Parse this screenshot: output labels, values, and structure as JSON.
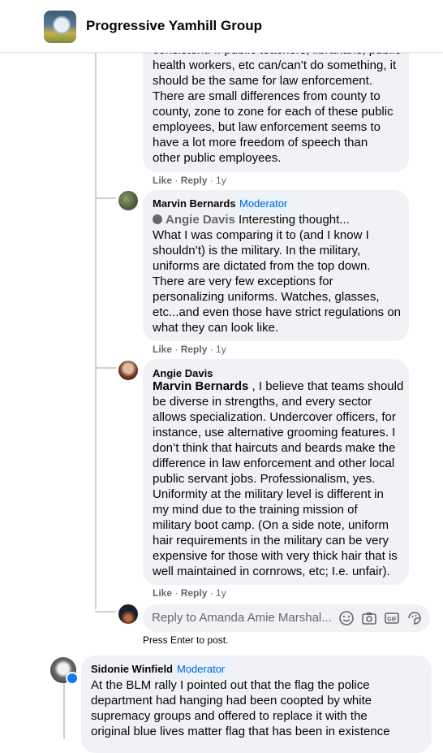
{
  "header": {
    "group_name": "Progressive Yamhill Group"
  },
  "comment_top": {
    "text": "consistent. If public teachers, librarians, public\nhealth workers, etc can/can’t do something, it\nshould be the same for law enforcement.\nThere are small differences from county to\ncounty, zone to zone for each of these public\nemployees, but law enforcement seems to\nhave a lot more freedom of speech than\nother public employees.",
    "like": "Like",
    "reply": "Reply",
    "age": "1y"
  },
  "comment_marvin": {
    "author": "Marvin Bernards",
    "badge": "Moderator",
    "mention": "Angie Davis",
    "first_line": "Interesting thought...",
    "text": "What I was comparing it to (and I know I\nshouldn’t) is the military. In the military,\nuniforms are dictated from the top down.\nThere are very few exceptions for\npersonalizing uniforms. Watches, glasses,\netc...and even those have strict regulations on\nwhat they can look like.",
    "like": "Like",
    "reply": "Reply",
    "age": "1y"
  },
  "comment_angie": {
    "author": "Angie Davis",
    "mention": "Marvin Bernards",
    "text_first": " , I believe that teams should",
    "text": "be diverse in strengths, and every sector\nallows specialization. Undercover officers, for\ninstance, use alternative grooming features. I\ndon’t think that haircuts and beards make the\ndifference in law enforcement and other local\npublic servant jobs. Professionalism, yes.\nUniformity at the military level is different in\nmy mind due to the training mission of\nmilitary boot camp. (On a side note, uniform\nhair requirements in the military can be very\nexpensive for those with very thick hair that is\nwell maintained in cornrows, etc; I.e. unfair).",
    "like": "Like",
    "reply": "Reply",
    "age": "1y"
  },
  "reply_box": {
    "placeholder": "Reply to Amanda Amie Marshal...",
    "hint": "Press Enter to post."
  },
  "comment_sidonie": {
    "author": "Sidonie Winfield",
    "badge": "Moderator",
    "text": "At the BLM rally I pointed out that the flag the police\ndepartment had hanging had been coopted by white\nsupremacy groups and offered to replace it with the\noriginal blue lives matter flag that has been in existence"
  },
  "icons": [
    "shield-icon",
    "emoji-icon",
    "camera-icon",
    "gif-icon",
    "sticker-icon"
  ],
  "colors": {
    "moderator_text": "#0064d1",
    "moderator_bg": "#e7f3ff",
    "bubble": "#f0f2f5",
    "meta": "#65676b"
  }
}
